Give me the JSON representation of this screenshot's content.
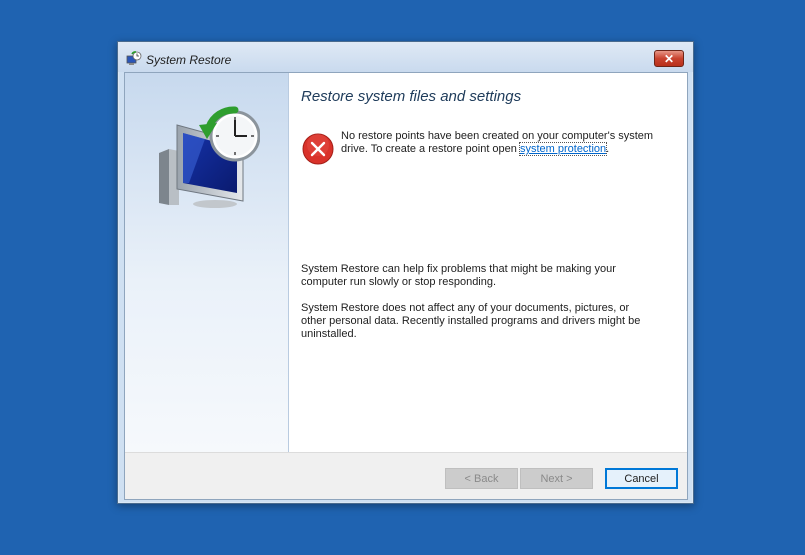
{
  "window": {
    "title": "System Restore",
    "close_label": "✕"
  },
  "content": {
    "heading": "Restore system files and settings",
    "error_text_before": "No restore points have been created on your computer's system drive. To create a restore point open ",
    "error_link": "system protection",
    "error_text_after": ".",
    "info_1": "System Restore can help fix problems that might be making your computer run slowly or stop responding.",
    "info_2": "System Restore does not affect any of your documents, pictures, or other personal data. Recently installed programs and drivers might be uninstalled."
  },
  "buttons": {
    "back": "< Back",
    "next": "Next >",
    "cancel": "Cancel"
  },
  "icons": {
    "app": "system-restore-icon",
    "illustration": "computer-clock-restore-icon",
    "error": "error-icon"
  },
  "colors": {
    "desktop": "#1f63b1",
    "error": "#d9322a",
    "link": "#0066cc"
  }
}
